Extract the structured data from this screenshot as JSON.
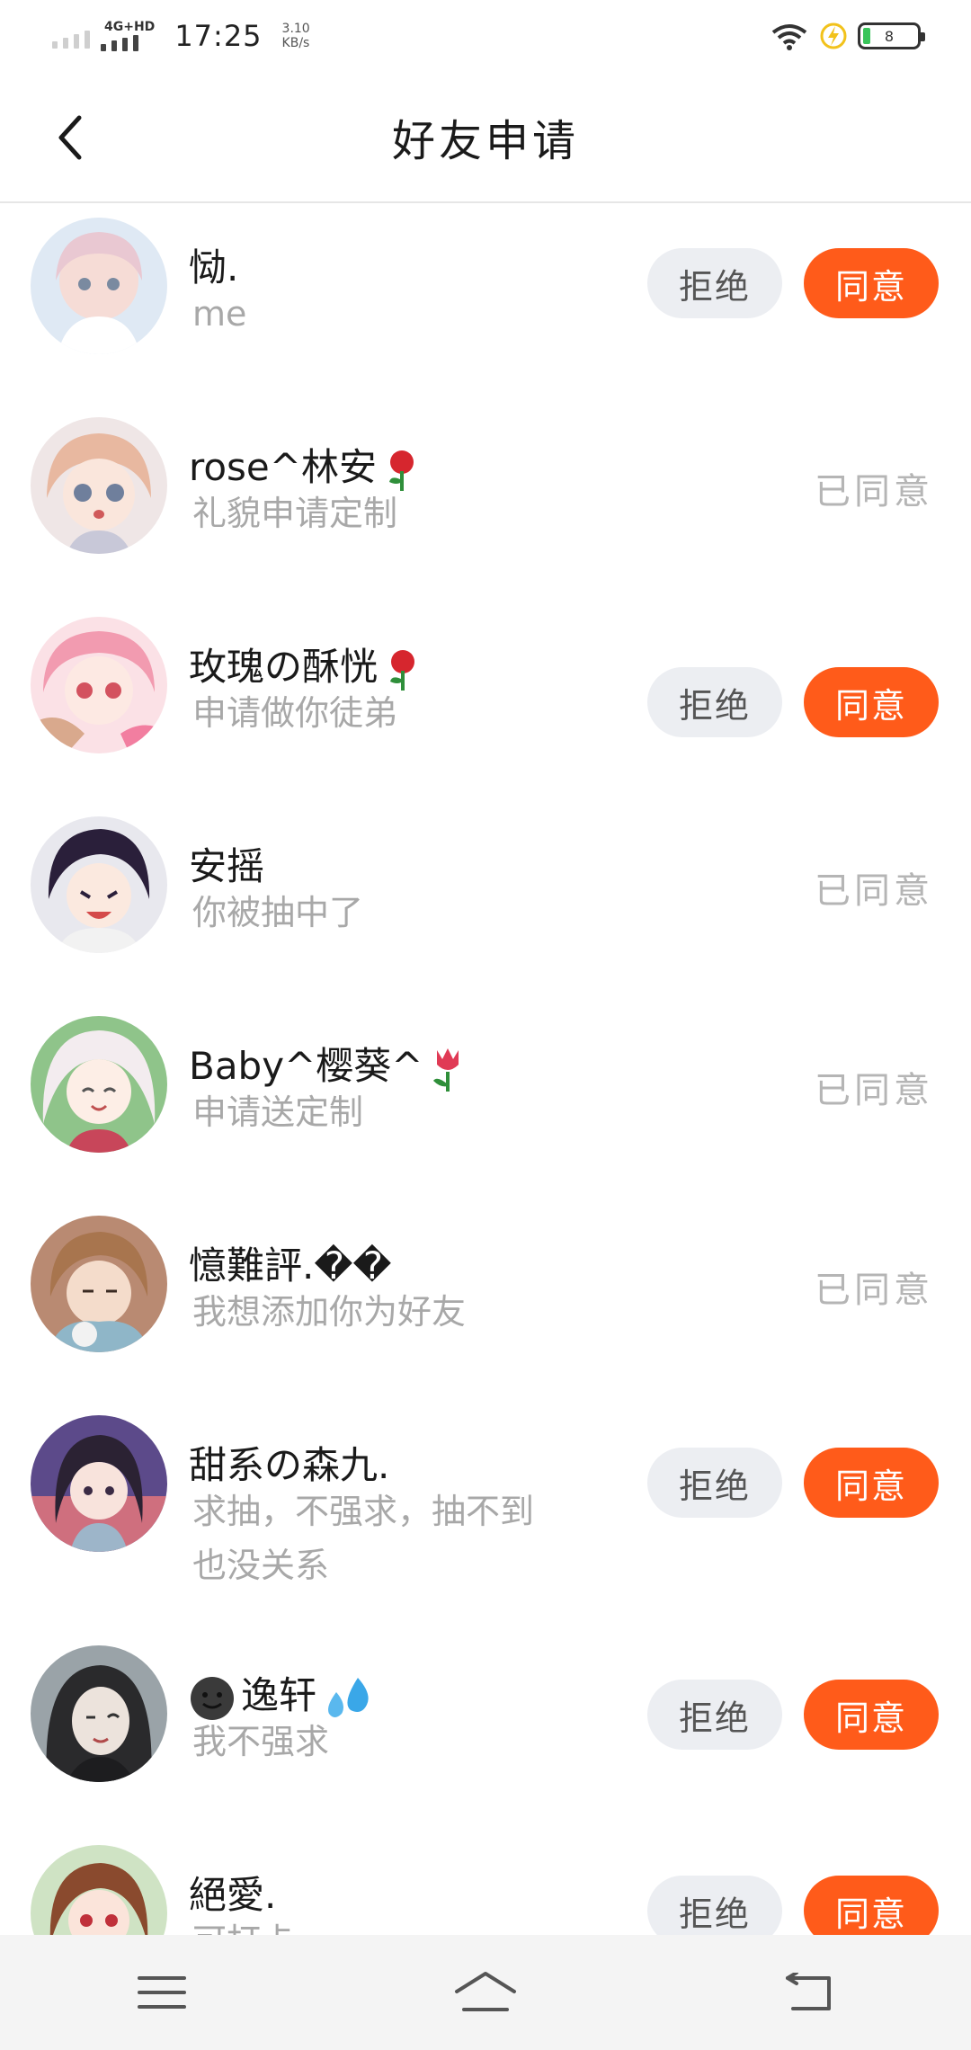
{
  "status_bar": {
    "network": "4G+HD",
    "time": "17:25",
    "speed_value": "3.10",
    "speed_unit": "KB/s",
    "battery": "8",
    "battery_color": "#39c45a"
  },
  "header": {
    "title": "好友申请",
    "back_icon": "chevron-left-icon"
  },
  "buttons": {
    "reject": "拒绝",
    "accept": "同意",
    "accepted_status": "已同意"
  },
  "colors": {
    "accent": "#ff5b1a",
    "reject_bg": "#eceef2",
    "muted_text": "#a8a8a8"
  },
  "requests": [
    {
      "name": "恸.",
      "message": "me",
      "state": "pending"
    },
    {
      "name": "rose^林安",
      "name_emoji": "rose-emoji",
      "message": "礼貌申请定制",
      "state": "accepted"
    },
    {
      "name": "玫瑰の酥恍",
      "name_emoji": "rose-emoji",
      "message": "申请做你徒弟",
      "state": "pending"
    },
    {
      "name": "安摇",
      "message": "你被抽中了",
      "state": "accepted"
    },
    {
      "name": "Baby^樱葵^",
      "name_emoji": "tulip-emoji",
      "message": "申请送定制",
      "state": "accepted"
    },
    {
      "name": "憶難評.��",
      "message": "我想添加你为好友",
      "state": "accepted"
    },
    {
      "name": "甜系の森九.",
      "message": "求抽，不强求，抽不到",
      "message_line2": "也没关系",
      "state": "pending"
    },
    {
      "name": "逸轩",
      "name_prefix_emoji": "dark-smiley-emoji",
      "name_emoji": "droplets-emoji",
      "message": "我不强求",
      "state": "pending"
    },
    {
      "name": "絕愛.",
      "message": "可打卡",
      "state": "pending"
    }
  ],
  "nav_bar": {
    "menu_icon": "menu-icon",
    "home_icon": "home-icon",
    "back_icon": "return-icon"
  }
}
